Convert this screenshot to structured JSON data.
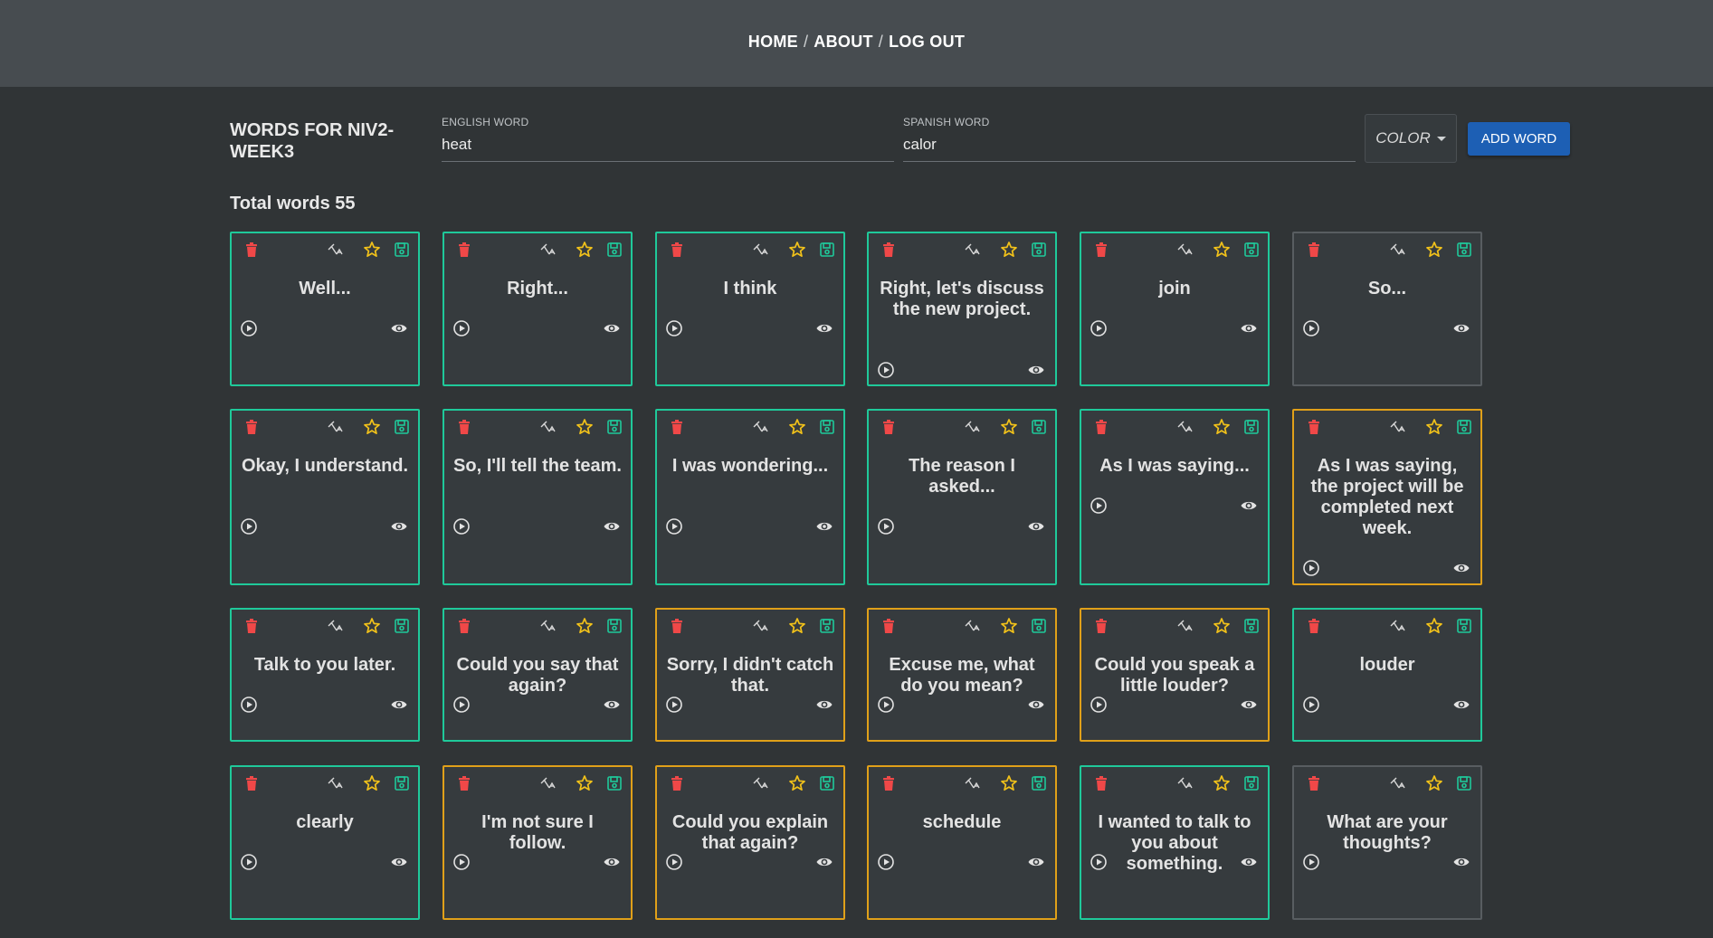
{
  "nav": {
    "home": "HOME",
    "about": "ABOUT",
    "logout": "LOG OUT",
    "separator": "/"
  },
  "form": {
    "title": "WORDS FOR NIV2-WEEK3",
    "english_label": "ENGLISH WORD",
    "english_value": "heat",
    "spanish_label": "SPANISH WORD",
    "spanish_value": "calor",
    "color_label": "COLOR",
    "add_label": "ADD WORD"
  },
  "total_words": "Total words 55",
  "colors": {
    "green": "#1fc99a",
    "orange": "#e0a019",
    "gray": "#585d61",
    "delete": "#f04848",
    "star": "#f2c21a",
    "save": "#1fc99a",
    "add_button": "#1d5fb4"
  },
  "cards": [
    {
      "word": "Well...",
      "color": "green"
    },
    {
      "word": "Right...",
      "color": "green"
    },
    {
      "word": "I think",
      "color": "green"
    },
    {
      "word": "Right, let's discuss the new project.",
      "color": "green"
    },
    {
      "word": "join",
      "color": "green"
    },
    {
      "word": "So...",
      "color": "gray"
    },
    {
      "word": "Okay, I understand.",
      "color": "green"
    },
    {
      "word": "So, I'll tell the team.",
      "color": "green"
    },
    {
      "word": "I was wondering...",
      "color": "green"
    },
    {
      "word": "The reason I asked...",
      "color": "green"
    },
    {
      "word": "As I was saying...",
      "color": "green"
    },
    {
      "word": "As I was saying, the project will be completed next week.",
      "color": "orange"
    },
    {
      "word": "Talk to you later.",
      "color": "green"
    },
    {
      "word": "Could you say that again?",
      "color": "green"
    },
    {
      "word": "Sorry, I didn't catch that.",
      "color": "orange"
    },
    {
      "word": "Excuse me, what do you mean?",
      "color": "orange"
    },
    {
      "word": "Could you speak a little louder?",
      "color": "orange"
    },
    {
      "word": "louder",
      "color": "green"
    },
    {
      "word": "clearly",
      "color": "green"
    },
    {
      "word": "I'm not sure I follow.",
      "color": "orange"
    },
    {
      "word": "Could you explain that again?",
      "color": "orange"
    },
    {
      "word": "schedule",
      "color": "orange"
    },
    {
      "word": "I wanted to talk to you about something.",
      "color": "green"
    },
    {
      "word": "What are your thoughts?",
      "color": "gray"
    }
  ]
}
